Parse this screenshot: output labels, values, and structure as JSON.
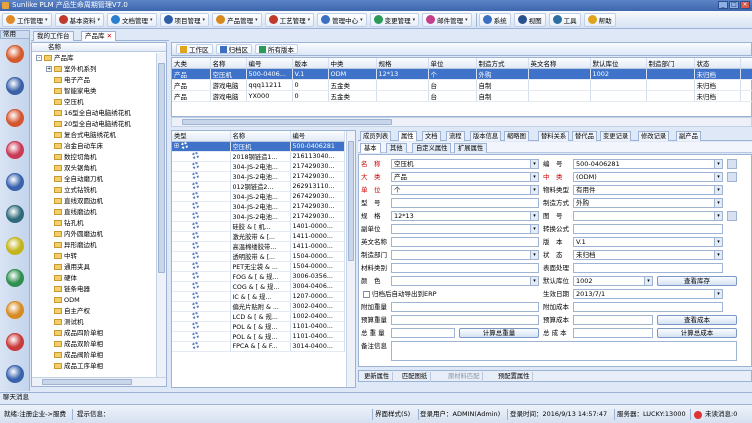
{
  "app": {
    "title": "Sunlike PLM 产品生命周期管理V7.0",
    "win_buttons": [
      "_",
      "□",
      "×"
    ]
  },
  "menu": [
    {
      "label": "工作管理",
      "icon": "work-icon",
      "color": "#e08a2a"
    },
    {
      "label": "基本资料",
      "icon": "base-icon",
      "color": "#c0392b"
    },
    {
      "label": "文档管理",
      "icon": "doc-icon",
      "color": "#2a7fd0"
    },
    {
      "label": "项目管理",
      "icon": "project-icon",
      "color": "#2d5ea8"
    },
    {
      "label": "产品管理",
      "icon": "product-icon",
      "color": "#d88a1f"
    },
    {
      "label": "工艺管理",
      "icon": "process-icon",
      "color": "#c0392b"
    },
    {
      "label": "管理中心",
      "icon": "center-icon",
      "color": "#3a6fc2"
    },
    {
      "label": "变更管理",
      "icon": "change-icon",
      "color": "#2a9a56"
    },
    {
      "label": "邮件管理",
      "icon": "mail-icon",
      "color": "#c2408a"
    },
    {
      "label": "系统",
      "icon": "system-icon",
      "color": "#3a6fc2"
    },
    {
      "label": "视图",
      "icon": "view-icon",
      "color": "#2a4f8f"
    },
    {
      "label": "工具",
      "icon": "tool-icon",
      "color": "#2a6fa0"
    },
    {
      "label": "帮助",
      "icon": "help-icon",
      "color": "#e0a51f"
    }
  ],
  "sidebar": {
    "header": "常用",
    "buttons": [
      {
        "name": "home",
        "color": "#d55a2c"
      },
      {
        "name": "settings",
        "color": "#3b62a8"
      },
      {
        "name": "gear",
        "color": "#d4552e"
      },
      {
        "name": "mail",
        "color": "#c93a55"
      },
      {
        "name": "user",
        "color": "#3a63ad"
      },
      {
        "name": "org",
        "color": "#2f6a7a"
      },
      {
        "name": "monitor",
        "color": "#c3b41a"
      },
      {
        "name": "cogs",
        "color": "#2f8f4e"
      },
      {
        "name": "tools",
        "color": "#d78b22"
      },
      {
        "name": "chart",
        "color": "#c93a3a"
      },
      {
        "name": "table",
        "color": "#3a63ad"
      }
    ]
  },
  "left_tabs": [
    "我的工作台",
    "产品库"
  ],
  "tree": {
    "header": "名称",
    "items": [
      {
        "label": "产品库",
        "level": 0,
        "exp": "-"
      },
      {
        "label": "室外机系列",
        "level": 1,
        "exp": "+"
      },
      {
        "label": "电子产品",
        "level": 1,
        "exp": ""
      },
      {
        "label": "智能家电类",
        "level": 1,
        "exp": ""
      },
      {
        "label": "空压机",
        "level": 1,
        "exp": ""
      },
      {
        "label": "16型全自动电脑绣花机",
        "level": 1,
        "exp": ""
      },
      {
        "label": "20型全自动电脑绣花机",
        "level": 1,
        "exp": ""
      },
      {
        "label": "复合式电脑绣花机",
        "level": 1,
        "exp": ""
      },
      {
        "label": "冶金自动车床",
        "level": 1,
        "exp": ""
      },
      {
        "label": "数控切角机",
        "level": 1,
        "exp": ""
      },
      {
        "label": "双头锯角机",
        "level": 1,
        "exp": ""
      },
      {
        "label": "全自动磨刀机",
        "level": 1,
        "exp": ""
      },
      {
        "label": "立式钻铣机",
        "level": 1,
        "exp": ""
      },
      {
        "label": "直线双圆边机",
        "level": 1,
        "exp": ""
      },
      {
        "label": "直线磨边机",
        "level": 1,
        "exp": ""
      },
      {
        "label": "钻孔机",
        "level": 1,
        "exp": ""
      },
      {
        "label": "内外圆磨边机",
        "level": 1,
        "exp": ""
      },
      {
        "label": "异形磨边机",
        "level": 1,
        "exp": ""
      },
      {
        "label": "中转",
        "level": 1,
        "exp": ""
      },
      {
        "label": "通用夹具",
        "level": 1,
        "exp": ""
      },
      {
        "label": "硬体",
        "level": 1,
        "exp": ""
      },
      {
        "label": "链条电器",
        "level": 1,
        "exp": ""
      },
      {
        "label": "ODM",
        "level": 1,
        "exp": ""
      },
      {
        "label": "自主产权",
        "level": 1,
        "exp": ""
      },
      {
        "label": "测试机",
        "level": 1,
        "exp": ""
      },
      {
        "label": "成品四阶单相",
        "level": 1,
        "exp": ""
      },
      {
        "label": "成品双阶单相",
        "level": 1,
        "exp": ""
      },
      {
        "label": "成品阀阶单相",
        "level": 1,
        "exp": ""
      },
      {
        "label": "成品工序单相",
        "level": 1,
        "exp": ""
      }
    ]
  },
  "toolbar": [
    {
      "label": "工作区",
      "color": "#e0a51f"
    },
    {
      "label": "归档区",
      "color": "#3a6fc2"
    },
    {
      "label": "所有版本",
      "color": "#2a9a56"
    }
  ],
  "top_grid": {
    "columns": [
      "大类",
      "名称",
      "编号",
      "版本",
      "中类",
      "规格",
      "单位",
      "制造方式",
      "英文名称",
      "默认库位",
      "制造部门",
      "状态"
    ],
    "rows": [
      {
        "sel": true,
        "cells": [
          "产品",
          "空压机",
          "500-0406...",
          "V.1",
          "ODM",
          "12*13",
          "个",
          "外购",
          "",
          "1002",
          "",
          "未归档"
        ]
      },
      {
        "sel": false,
        "cells": [
          "产品",
          "游戏电脑",
          "qqq11211",
          "0",
          "五金类",
          "",
          "台",
          "自制",
          "",
          "",
          "",
          "未归档"
        ]
      },
      {
        "sel": false,
        "cells": [
          "产品",
          "游戏电脑",
          "YX000",
          "0",
          "五金类",
          "",
          "台",
          "自制",
          "",
          "",
          "",
          "未归档"
        ]
      }
    ]
  },
  "bottom_grid": {
    "columns": [
      "类型",
      "名称",
      "编号"
    ],
    "rows": [
      {
        "sel": true,
        "type": "⊞",
        "name": "空压机",
        "code": "500-0406281"
      },
      {
        "sel": false,
        "type": "gear",
        "name": "2018钢链造1...",
        "code": "216113040..."
      },
      {
        "sel": false,
        "type": "gear",
        "name": "304-JS-2电池...",
        "code": "217429030..."
      },
      {
        "sel": false,
        "type": "gear",
        "name": "304-JS-2电池...",
        "code": "217429030..."
      },
      {
        "sel": false,
        "type": "gear",
        "name": "012钢链造2...",
        "code": "262913110..."
      },
      {
        "sel": false,
        "type": "gear",
        "name": "304-JS-2电池...",
        "code": "267429030..."
      },
      {
        "sel": false,
        "type": "gear",
        "name": "304-JS-2电池...",
        "code": "217429030..."
      },
      {
        "sel": false,
        "type": "gear",
        "name": "304-JS-2电池...",
        "code": "217429030..."
      },
      {
        "sel": false,
        "type": "gear",
        "name": "硅胶 & [ 机...",
        "code": "1401-0000..."
      },
      {
        "sel": false,
        "type": "gear",
        "name": "激光胶带 & [...",
        "code": "1411-0000..."
      },
      {
        "sel": false,
        "type": "gear",
        "name": "高温棉缕胶带...",
        "code": "1411-0000..."
      },
      {
        "sel": false,
        "type": "gear",
        "name": "透明胶带 & [...",
        "code": "1504-0000..."
      },
      {
        "sel": false,
        "type": "gear",
        "name": "PET无尘袋 & ...",
        "code": "1504-0000..."
      },
      {
        "sel": false,
        "type": "gear",
        "name": "FOG & [ & 规...",
        "code": "3006-0356..."
      },
      {
        "sel": false,
        "type": "gear",
        "name": "COG & [ & 规...",
        "code": "3004-0406..."
      },
      {
        "sel": false,
        "type": "gear",
        "name": "IC & [ & 规...",
        "code": "1207-0000..."
      },
      {
        "sel": false,
        "type": "gear",
        "name": "偏光片贴附 & ...",
        "code": "3002-0400..."
      },
      {
        "sel": false,
        "type": "gear",
        "name": "LCD & [ & 规...",
        "code": "1002-0400..."
      },
      {
        "sel": false,
        "type": "gear",
        "name": "POL & [ & 规...",
        "code": "1101-0400..."
      },
      {
        "sel": false,
        "type": "gear",
        "name": "POL & [ & 规...",
        "code": "1101-0400..."
      },
      {
        "sel": false,
        "type": "gear",
        "name": "FPCA & [ & F...",
        "code": "3014-0400..."
      }
    ]
  },
  "detail_tabs": [
    "成员列表",
    "属性",
    "文档",
    "流程",
    "版本信息",
    "缩略图",
    "替料关系",
    "替代品",
    "变更记录",
    "修改记录",
    "副产品"
  ],
  "sub_tabs": [
    "基本",
    "其他",
    "自定义属性",
    "扩展属性"
  ],
  "form": {
    "name_lbl": "名　称",
    "name_val": "空压机",
    "code_lbl": "编　号",
    "code_val": "500-0406281",
    "big_lbl": "大　类",
    "big_val": "产品",
    "mid_lbl": "中　类",
    "mid_val": "(ODM)",
    "unit_lbl": "单　位",
    "unit_val": "个",
    "mtype_lbl": "物料类型",
    "mtype_val": "有用件",
    "model_lbl": "型　号",
    "model_val": "",
    "make_lbl": "制造方式",
    "make_val": "外购",
    "spec_lbl": "规　格",
    "spec_val": "12*13",
    "draw_lbl": "图　号",
    "draw_val": "",
    "sub_lbl": "副单位",
    "sub_val": "",
    "conv_lbl": "转换公式",
    "conv_val": "",
    "en_lbl": "英文名称",
    "en_val": "",
    "ver_lbl": "版　本",
    "ver_val": "V.1",
    "dept_lbl": "制造部门",
    "dept_val": "",
    "state_lbl": "状　态",
    "state_val": "未归档",
    "mat_lbl": "材料类别",
    "mat_val": "",
    "surf_lbl": "表面处理",
    "surf_val": "",
    "color_lbl": "颜　色",
    "color_val": "",
    "loc_lbl": "默认库位",
    "loc_val": "1002",
    "stock_btn": "查看库存",
    "erp_lbl": "归档后自动导出到ERP",
    "date_lbl": "生效日期",
    "date_val": "2013/7/1",
    "addw_lbl": "附加重量",
    "addw_val": "",
    "addc_lbl": "附加成本",
    "addc_val": "",
    "prew_lbl": "预算重量",
    "prew_val": "",
    "prec_lbl": "预算成本",
    "prec_val": "",
    "cost_btn": "查看成本",
    "totw_lbl": "总 重 量",
    "totw_val": "",
    "calcw_btn": "计算总重量",
    "totc_lbl": "总 成 本",
    "totc_val": "",
    "calcc_btn": "计算总成本",
    "note_lbl": "备注信息",
    "note_val": ""
  },
  "bottom_tabs": [
    "更新属性",
    "匹配图纸",
    "原材料匹配",
    "预配置属性"
  ],
  "msgbar": "聊天消息",
  "status": {
    "module": "就绪:注册企业->服费",
    "hint": "提示信息：",
    "skin": "界面样式(S)",
    "user": "登录用户：ADMIN(Admin)",
    "login_time": "登录时间：2016/9/13 14:57:47",
    "server": "服务器：LUCKY:13000",
    "msg": "未读消息:0"
  }
}
